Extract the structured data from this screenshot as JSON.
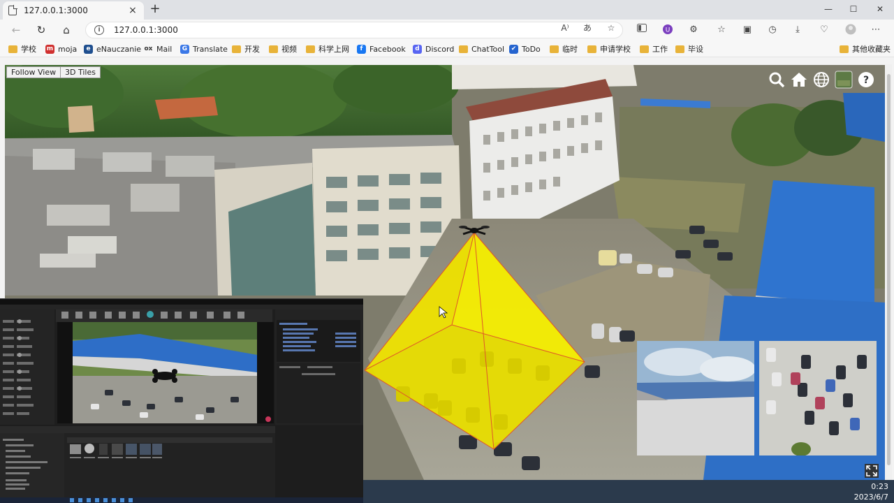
{
  "browser": {
    "tab_title": "127.0.0.1:3000",
    "tab_close": "×",
    "new_tab": "+",
    "window_controls": {
      "minimize": "—",
      "maximize": "☐",
      "close": "✕"
    },
    "url": "127.0.0.1:3000",
    "read_aloud": "A⁾",
    "translate": "あ",
    "bookmarks": [
      {
        "label": "学校",
        "kind": "folder"
      },
      {
        "label": "moja",
        "kind": "moja"
      },
      {
        "label": "eNauczanie",
        "kind": "enauczanie"
      },
      {
        "label": "Mail",
        "kind": "mail"
      },
      {
        "label": "Translate",
        "kind": "translate"
      },
      {
        "label": "开发",
        "kind": "folder"
      },
      {
        "label": "视频",
        "kind": "folder"
      },
      {
        "label": "科学上网",
        "kind": "folder"
      },
      {
        "label": "Facebook",
        "kind": "facebook"
      },
      {
        "label": "Discord",
        "kind": "discord"
      },
      {
        "label": "ChatTool",
        "kind": "folder"
      },
      {
        "label": "ToDo",
        "kind": "todo"
      },
      {
        "label": "临时",
        "kind": "folder"
      },
      {
        "label": "申请学校",
        "kind": "folder"
      },
      {
        "label": "工作",
        "kind": "folder"
      },
      {
        "label": "毕设",
        "kind": "folder"
      }
    ],
    "other_bookmarks": "其他收藏夹"
  },
  "viewer": {
    "follow_view_label": "Follow View",
    "tiles_label": "3D Tiles"
  },
  "system": {
    "time": "0:23",
    "date": "2023/6/7"
  },
  "colors": {
    "frustum": "#f4ee00",
    "roof_blue": "#2f74cf"
  }
}
